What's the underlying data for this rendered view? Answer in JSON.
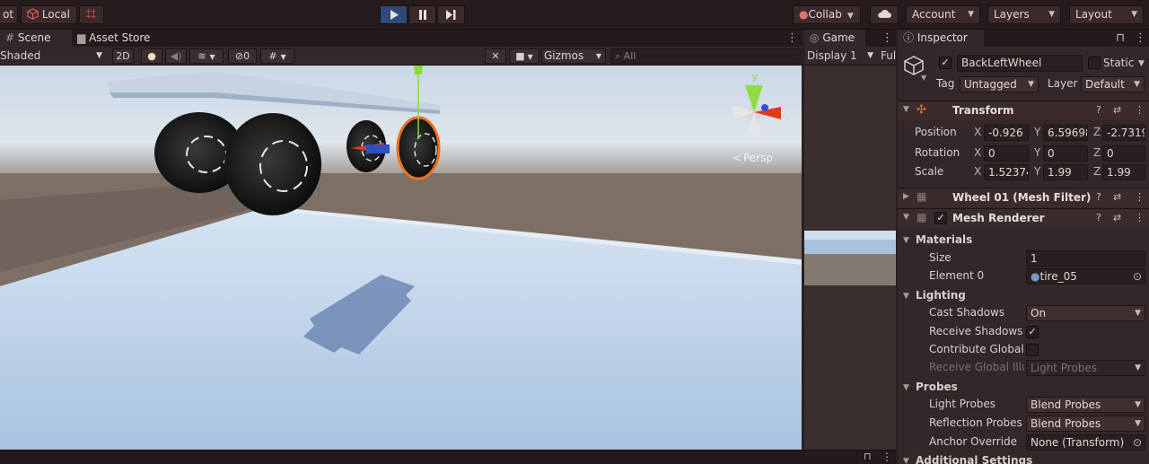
{
  "toolbar": {
    "pivot_label": "ot",
    "local_label": "Local",
    "collab_label": "Collab",
    "account_label": "Account",
    "layers_label": "Layers",
    "layout_label": "Layout"
  },
  "scene_panel": {
    "tabs": [
      {
        "label": "Scene",
        "icon": "hash-icon"
      },
      {
        "label": "Asset Store",
        "icon": "bag-icon"
      }
    ],
    "shading_mode": "Shaded",
    "mode_2d": "2D",
    "hidden_count": "0",
    "gizmos_label": "Gizmos",
    "search_placeholder": "All",
    "persp_label": "Persp",
    "gizmo_y": "y",
    "gizmo_z": "z"
  },
  "game_panel": {
    "tab_label": "Game",
    "display_label": "Display 1",
    "aspect_label": "Ful"
  },
  "inspector": {
    "tab_label": "Inspector",
    "object_name": "BackLeftWheel",
    "static_label": "Static",
    "tag_label": "Tag",
    "tag_value": "Untagged",
    "layer_label": "Layer",
    "layer_value": "Default",
    "transform": {
      "title": "Transform",
      "position_label": "Position",
      "rotation_label": "Rotation",
      "scale_label": "Scale",
      "position": {
        "x": "-0.926",
        "y": "6.59698",
        "z": "-2.7319"
      },
      "rotation": {
        "x": "0",
        "y": "0",
        "z": "0"
      },
      "scale": {
        "x": "1.52374",
        "y": "1.99",
        "z": "1.99"
      }
    },
    "mesh_filter_title": "Wheel 01 (Mesh Filter)",
    "mesh_renderer": {
      "title": "Mesh Renderer",
      "materials_label": "Materials",
      "size_label": "Size",
      "size_value": "1",
      "element0_label": "Element 0",
      "element0_value": "tire_05",
      "lighting_label": "Lighting",
      "cast_shadows_label": "Cast Shadows",
      "cast_shadows_value": "On",
      "receive_shadows_label": "Receive Shadows",
      "contribute_gi_label": "Contribute Global",
      "receive_gi_label": "Receive Global Illu",
      "receive_gi_value": "Light Probes",
      "probes_label": "Probes",
      "light_probes_label": "Light Probes",
      "light_probes_value": "Blend Probes",
      "reflection_probes_label": "Reflection Probes",
      "reflection_probes_value": "Blend Probes",
      "anchor_override_label": "Anchor Override",
      "anchor_override_value": "None (Transform)",
      "additional_settings_label": "Additional Settings"
    }
  },
  "colors": {
    "panel_bg": "#33272a",
    "accent_orange": "#f07020",
    "active_play": "#2f4a7a"
  }
}
